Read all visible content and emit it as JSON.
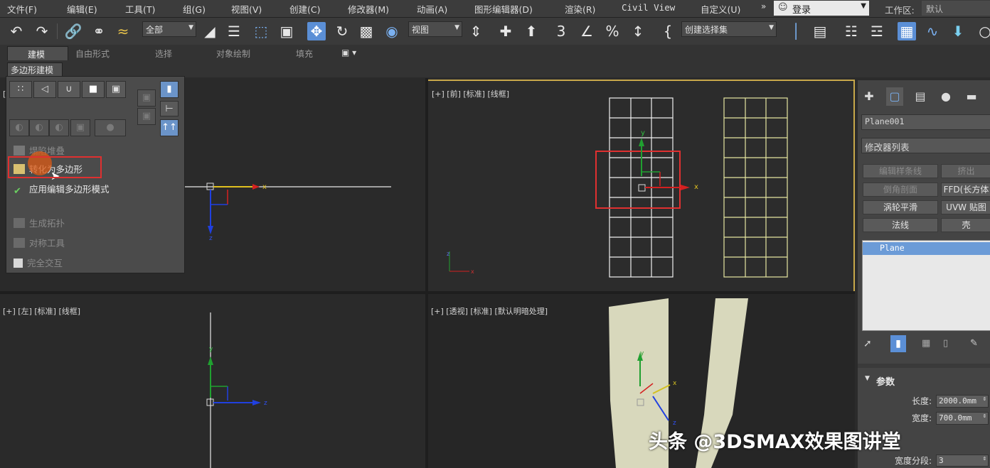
{
  "menubar": {
    "items": [
      "文件(F)",
      "编辑(E)",
      "工具(T)",
      "组(G)",
      "视图(V)",
      "创建(C)",
      "修改器(M)",
      "动画(A)",
      "图形编辑器(D)",
      "渲染(R)",
      "Civil View",
      "自定义(U)"
    ],
    "more": "»",
    "login": "登录",
    "workspace_label": "工作区:",
    "workspace_value": "默认"
  },
  "toolbar": {
    "selection_filter": "全部",
    "ref_coord": "视图",
    "named_selection": "创建选择集"
  },
  "ribbon": {
    "tabs": [
      "建模",
      "自由形式",
      "选择",
      "对象绘制",
      "填充"
    ],
    "active_tab": "建模",
    "subtab": "多边形建模"
  },
  "poly_panel": {
    "rows": [
      "塌陷堆叠",
      "转化为多边形",
      "应用编辑多边形模式",
      "生成拓扑",
      "对称工具",
      "完全交互"
    ]
  },
  "viewports": {
    "top_left_label": "[",
    "front_label": "[+] [前] [标准] [线框]",
    "left_label": "[+] [左] [标准] [线框]",
    "persp_label": "[+] [透视] [标准] [默认明暗处理]"
  },
  "command_panel": {
    "object_name": "Plane001",
    "modifier_list": "修改器列表",
    "modifier_buttons": [
      [
        "编辑样条线",
        "挤出"
      ],
      [
        "倒角剖面",
        "FFD(长方体"
      ],
      [
        "涡轮平滑",
        "UVW 贴图"
      ],
      [
        "法线",
        "壳"
      ]
    ],
    "stack_item": "Plane",
    "params_title": "参数",
    "length_label": "长度:",
    "length_value": "2000.0mm",
    "width_label": "宽度:",
    "width_value": "700.0mm",
    "width_segs_label": "宽度分段:",
    "width_segs_value": "3"
  },
  "watermark": "头条 @3DSMAX效果图讲堂",
  "colors": {
    "accent": "#5b8fd6",
    "highlight_red": "#e03030",
    "wire_white": "#ffffff",
    "wire_yellow": "#e6e6a0",
    "viewport_border": "#c8a84a"
  }
}
